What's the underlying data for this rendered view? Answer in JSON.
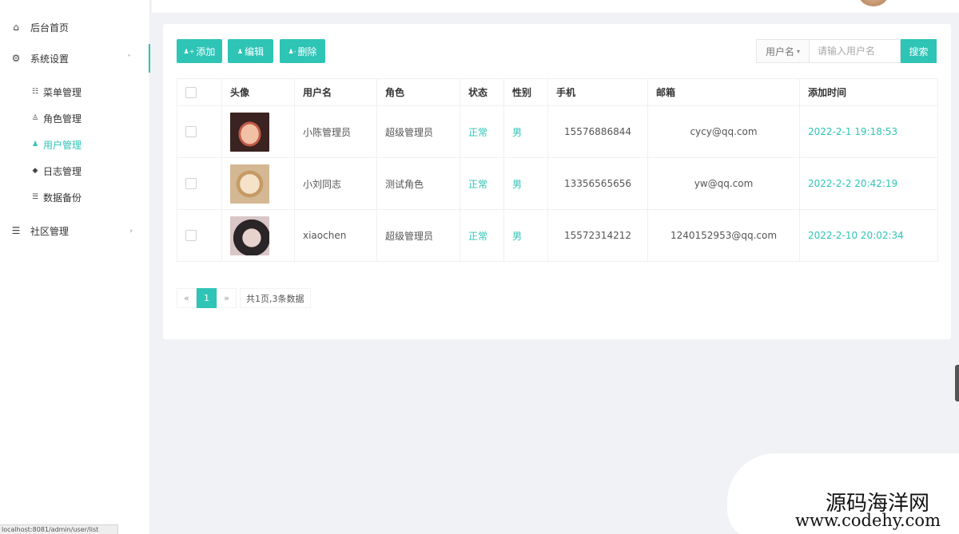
{
  "sidebar": {
    "items": [
      {
        "icon": "home-icon",
        "label": "后台首页"
      },
      {
        "icon": "gear-icon",
        "label": "系统设置",
        "arrow": "˅"
      },
      {
        "icon": "layers-icon",
        "label": "社区管理",
        "arrow": "›"
      }
    ],
    "sub_items": [
      {
        "icon": "list-icon",
        "label": "菜单管理"
      },
      {
        "icon": "user-role-icon",
        "label": "角色管理"
      },
      {
        "icon": "users-icon",
        "label": "用户管理",
        "active": true
      },
      {
        "icon": "tag-icon",
        "label": "日志管理"
      },
      {
        "icon": "database-icon",
        "label": "数据备份"
      }
    ]
  },
  "status_url": "localhost:8081/admin/user/list",
  "toolbar": {
    "add_label": "添加",
    "edit_label": "编辑",
    "delete_label": "删除"
  },
  "search": {
    "field_select": "用户名",
    "placeholder": "请输入用户名",
    "button_label": "搜索"
  },
  "table": {
    "columns": [
      "头像",
      "用户名",
      "角色",
      "状态",
      "性别",
      "手机",
      "邮箱",
      "添加时间"
    ],
    "rows": [
      {
        "avatar": "avatar-woman",
        "username": "小陈管理员",
        "role": "超级管理员",
        "status": "正常",
        "gender": "男",
        "phone": "15576886844",
        "email": "cycy@qq.com",
        "created": "2022-2-1 19:18:53"
      },
      {
        "avatar": "avatar-sketch",
        "username": "小刘同志",
        "role": "测试角色",
        "status": "正常",
        "gender": "男",
        "phone": "13356565656",
        "email": "yw@qq.com",
        "created": "2022-2-2 20:42:19"
      },
      {
        "avatar": "avatar-dark",
        "username": "xiaochen",
        "role": "超级管理员",
        "status": "正常",
        "gender": "男",
        "phone": "15572314212",
        "email": "1240152953@qq.com",
        "created": "2022-2-10 20:02:34"
      }
    ]
  },
  "pagination": {
    "prev": "«",
    "current": "1",
    "next": "»",
    "info": "共1页,3条数据"
  },
  "watermark": {
    "name": "源码海洋网",
    "url": "www.codehy.com"
  },
  "colors": {
    "accent": "#2ec4b6",
    "background": "#f1f2f5"
  }
}
